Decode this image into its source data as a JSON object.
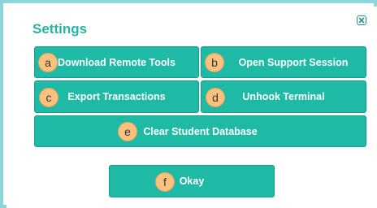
{
  "dialog": {
    "title": "Settings",
    "close_icon": "close-icon"
  },
  "buttons": [
    {
      "badge": "a",
      "label": "Download Remote Tools"
    },
    {
      "badge": "b",
      "label": "Open Support Session"
    },
    {
      "badge": "c",
      "label": "Export Transactions"
    },
    {
      "badge": "d",
      "label": "Unhook Terminal"
    },
    {
      "badge": "e",
      "label": "Clear Student Database"
    },
    {
      "badge": "f",
      "label": "Okay"
    }
  ],
  "colors": {
    "accent": "#1fbaa5",
    "title": "#2ab3a0",
    "frame": "#8fd3dc",
    "badge": "#fbc27f"
  }
}
